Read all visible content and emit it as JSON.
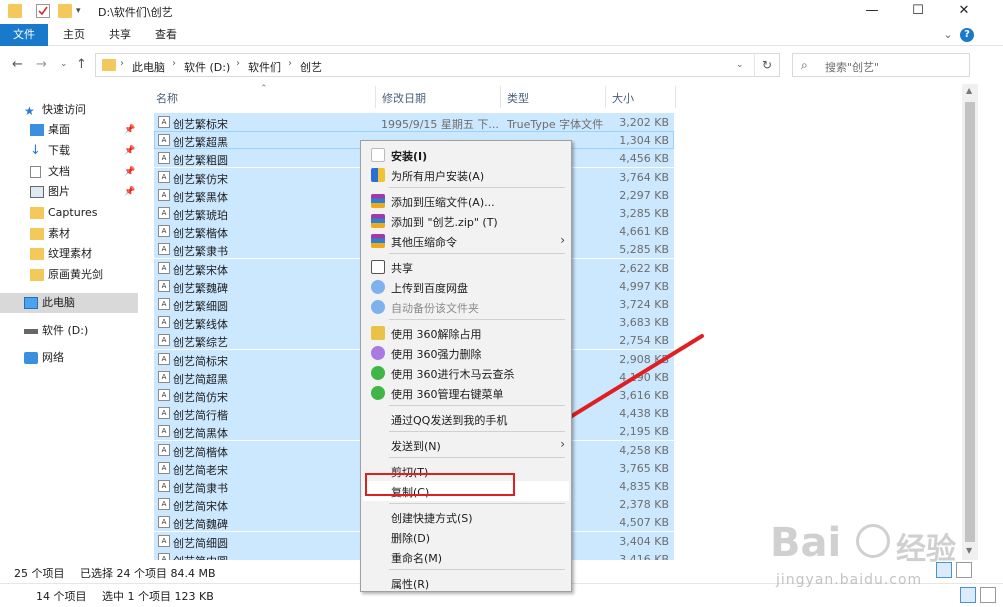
{
  "window": {
    "title": "D:\\软件们\\创艺",
    "minimize": "—",
    "maximize": "☐",
    "close": "✕"
  },
  "ribbon": {
    "tabs": [
      "文件",
      "主页",
      "共享",
      "查看"
    ],
    "expand": "⌄",
    "help": "?"
  },
  "address": {
    "crumbs": [
      "此电脑",
      "软件 (D:)",
      "软件们",
      "创艺"
    ],
    "search_placeholder": "搜索\"创艺\""
  },
  "nav": {
    "items": [
      {
        "label": "快速访问",
        "icon": "star-icon"
      },
      {
        "label": "桌面",
        "icon": "desktop-icon",
        "pinned": true
      },
      {
        "label": "下载",
        "icon": "download-icon",
        "pinned": true
      },
      {
        "label": "文档",
        "icon": "document-icon",
        "pinned": true
      },
      {
        "label": "图片",
        "icon": "picture-icon",
        "pinned": true
      },
      {
        "label": "Captures",
        "icon": "folder-icon"
      },
      {
        "label": "素材",
        "icon": "folder-icon"
      },
      {
        "label": "纹理素材",
        "icon": "folder-icon"
      },
      {
        "label": "原画黄光剑",
        "icon": "folder-icon"
      },
      {
        "label": "此电脑",
        "icon": "computer-icon",
        "selected": true
      },
      {
        "label": "软件 (D:)",
        "icon": "drive-icon"
      },
      {
        "label": "网络",
        "icon": "network-icon"
      }
    ]
  },
  "columns": {
    "name": "名称",
    "date": "修改日期",
    "type": "类型",
    "size": "大小"
  },
  "files": [
    {
      "name": "创艺繁标宋",
      "date": "1995/9/15 星期五 下...",
      "type": "TrueType 字体文件",
      "size": "3,202 KB"
    },
    {
      "name": "创艺繁超黑",
      "size": "1,304 KB"
    },
    {
      "name": "创艺繁粗圆",
      "size": "4,456 KB"
    },
    {
      "name": "创艺繁仿宋",
      "size": "3,764 KB"
    },
    {
      "name": "创艺繁黑体",
      "size": "2,297 KB"
    },
    {
      "name": "创艺繁琥珀",
      "size": "3,285 KB"
    },
    {
      "name": "创艺繁楷体",
      "size": "4,661 KB"
    },
    {
      "name": "创艺繁隶书",
      "size": "5,285 KB"
    },
    {
      "name": "创艺繁宋体",
      "size": "2,622 KB"
    },
    {
      "name": "创艺繁魏碑",
      "size": "4,997 KB"
    },
    {
      "name": "创艺繁细圆",
      "size": "3,724 KB"
    },
    {
      "name": "创艺繁线体",
      "size": "3,683 KB"
    },
    {
      "name": "创艺繁综艺",
      "size": "2,754 KB"
    },
    {
      "name": "创艺简标宋",
      "size": "2,908 KB"
    },
    {
      "name": "创艺简超黑",
      "size": "4,190 KB"
    },
    {
      "name": "创艺简仿宋",
      "size": "3,616 KB"
    },
    {
      "name": "创艺简行楷",
      "size": "4,438 KB"
    },
    {
      "name": "创艺简黑体",
      "size": "2,195 KB"
    },
    {
      "name": "创艺简楷体",
      "size": "4,258 KB"
    },
    {
      "name": "创艺简老宋",
      "size": "3,765 KB"
    },
    {
      "name": "创艺简隶书",
      "size": "4,835 KB"
    },
    {
      "name": "创艺简宋体",
      "size": "2,378 KB"
    },
    {
      "name": "创艺简魏碑",
      "size": "4,507 KB"
    },
    {
      "name": "创艺简细圆",
      "size": "3,404 KB"
    },
    {
      "name": "创艺简中圆",
      "size": "3,416 KB"
    }
  ],
  "status": {
    "count": "25 个项目",
    "selected": "已选择 24 个项目  84.4 MB",
    "count2": "14 个项目",
    "selected2": "选中 1 个项目  123 KB"
  },
  "context_menu": {
    "items": [
      {
        "label": "安装(I)",
        "bold": true,
        "icon": "install-icon"
      },
      {
        "label": "为所有用户安装(A)",
        "icon": "shield-icon"
      },
      {
        "sep": true
      },
      {
        "label": "添加到压缩文件(A)...",
        "icon": "winrar-icon"
      },
      {
        "label": "添加到 \"创艺.zip\" (T)",
        "icon": "winrar-icon"
      },
      {
        "label": "其他压缩命令",
        "icon": "winrar-icon",
        "submenu": true
      },
      {
        "sep": true
      },
      {
        "label": "共享",
        "icon": "share-icon"
      },
      {
        "label": "上传到百度网盘",
        "icon": "baidu-cloud-icon"
      },
      {
        "label": "自动备份该文件夹",
        "icon": "baidu-cloud-icon",
        "disabled": true
      },
      {
        "sep": true
      },
      {
        "label": "使用 360解除占用",
        "icon": "unlock-360-icon"
      },
      {
        "label": "使用 360强力删除",
        "icon": "delete-360-icon"
      },
      {
        "label": "使用 360进行木马云查杀",
        "icon": "scan-360-icon"
      },
      {
        "label": "使用 360管理右键菜单",
        "icon": "manage-360-icon"
      },
      {
        "sep": true
      },
      {
        "label": "通过QQ发送到我的手机",
        "icon": "none"
      },
      {
        "sep": true
      },
      {
        "label": "发送到(N)",
        "icon": "none",
        "submenu": true
      },
      {
        "sep": true
      },
      {
        "label": "剪切(T)",
        "icon": "none"
      },
      {
        "label": "复制(C)",
        "icon": "none",
        "highlight": true
      },
      {
        "sep": true
      },
      {
        "label": "创建快捷方式(S)",
        "icon": "none"
      },
      {
        "label": "删除(D)",
        "icon": "none"
      },
      {
        "label": "重命名(M)",
        "icon": "none"
      },
      {
        "sep": true
      },
      {
        "label": "属性(R)",
        "icon": "none"
      }
    ]
  },
  "watermark": {
    "brand_a": "Bai",
    "brand_b": "经验",
    "url": "jingyan.baidu.com"
  },
  "colors": {
    "selection": "#cce8ff",
    "accent": "#1979ca",
    "annotation": "#e02020"
  }
}
